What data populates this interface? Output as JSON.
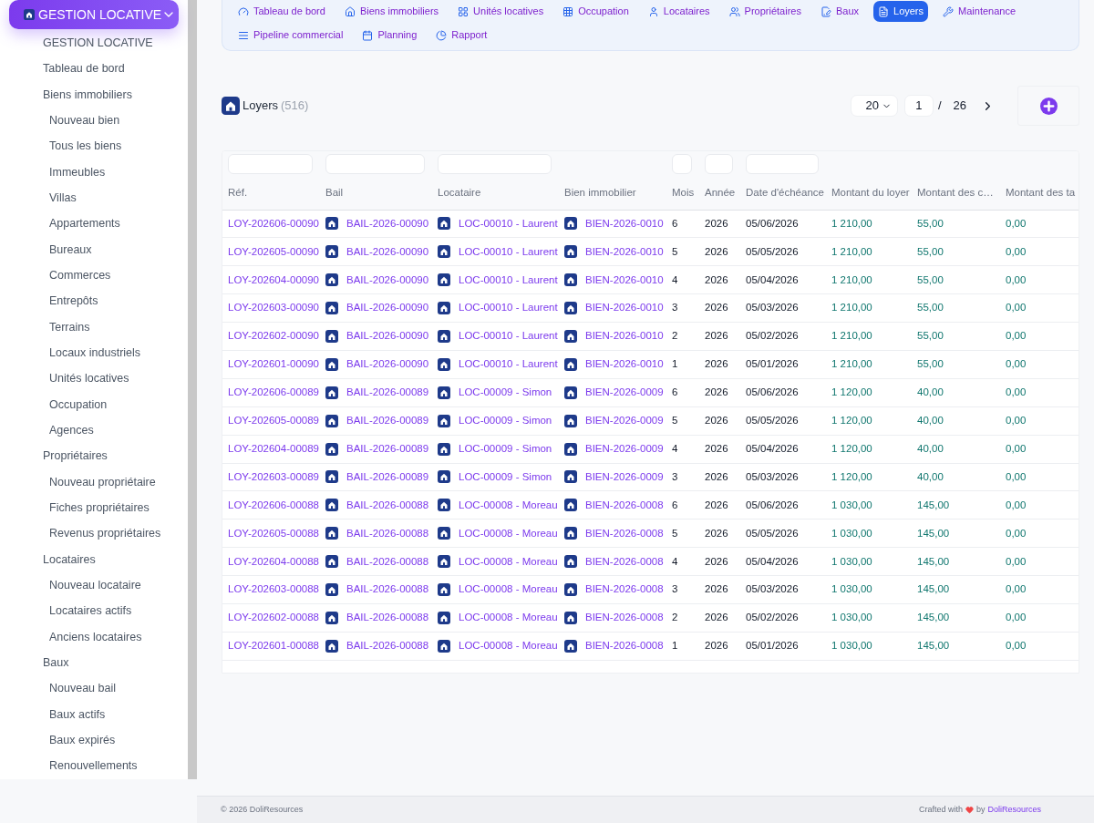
{
  "sidebar": {
    "header": {
      "title": "GESTION LOCATIVE"
    },
    "items": [
      {
        "label": "GESTION LOCATIVE"
      },
      {
        "label": "Tableau de bord"
      },
      {
        "label": "Biens immobiliers",
        "children": [
          {
            "label": "Nouveau bien"
          },
          {
            "label": "Tous les biens"
          },
          {
            "label": "Immeubles"
          },
          {
            "label": "Villas"
          },
          {
            "label": "Appartements"
          },
          {
            "label": "Bureaux"
          },
          {
            "label": "Commerces"
          },
          {
            "label": "Entrepôts"
          },
          {
            "label": "Terrains"
          },
          {
            "label": "Locaux industriels"
          },
          {
            "label": "Unités locatives"
          },
          {
            "label": "Occupation"
          },
          {
            "label": "Agences"
          }
        ]
      },
      {
        "label": "Propriétaires",
        "children": [
          {
            "label": "Nouveau propriétaire"
          },
          {
            "label": "Fiches propriétaires"
          },
          {
            "label": "Revenus propriétaires"
          }
        ]
      },
      {
        "label": "Locataires",
        "children": [
          {
            "label": "Nouveau locataire"
          },
          {
            "label": "Locataires actifs"
          },
          {
            "label": "Anciens locataires"
          }
        ]
      },
      {
        "label": "Baux",
        "children": [
          {
            "label": "Nouveau bail"
          },
          {
            "label": "Baux actifs"
          },
          {
            "label": "Baux expirés"
          },
          {
            "label": "Renouvellements"
          }
        ]
      }
    ]
  },
  "nav_tabs": [
    {
      "label": "Tableau de bord",
      "selected": false
    },
    {
      "label": "Biens immobiliers",
      "selected": false
    },
    {
      "label": "Unités locatives",
      "selected": false
    },
    {
      "label": "Occupation",
      "selected": false
    },
    {
      "label": "Locataires",
      "selected": false
    },
    {
      "label": "Propriétaires",
      "selected": false
    },
    {
      "label": "Baux",
      "selected": false
    },
    {
      "label": "Loyers",
      "selected": true
    },
    {
      "label": "Maintenance",
      "selected": false
    },
    {
      "label": "Pipeline commercial",
      "selected": false
    },
    {
      "label": "Planning",
      "selected": false
    },
    {
      "label": "Rapport",
      "selected": false
    }
  ],
  "page_header": {
    "title": "Loyers",
    "count": "(516)"
  },
  "pagination": {
    "page_size": "20",
    "page": "1",
    "separator": "/",
    "total": "26"
  },
  "table": {
    "columns": [
      {
        "label": "Réf.",
        "filter": true
      },
      {
        "label": "Bail",
        "filter": true
      },
      {
        "label": "Locataire",
        "filter": true
      },
      {
        "label": "Bien immobilier",
        "filter": false
      },
      {
        "label": "Mois",
        "filter": true
      },
      {
        "label": "Année",
        "filter": true
      },
      {
        "label": "Date d'échéance",
        "filter": true
      },
      {
        "label": "Montant du loyer",
        "filter": false
      },
      {
        "label": "Montant des c…",
        "filter": false
      },
      {
        "label": "Montant des ta",
        "filter": false
      }
    ],
    "rows": [
      [
        "LOY-202606-00090",
        "BAIL-2026-00090",
        "LOC-00010 - Laurent",
        "BIEN-2026-0010",
        "6",
        "2026",
        "05/06/2026",
        "1 210,00",
        "55,00",
        "0,00"
      ],
      [
        "LOY-202605-00090",
        "BAIL-2026-00090",
        "LOC-00010 - Laurent",
        "BIEN-2026-0010",
        "5",
        "2026",
        "05/05/2026",
        "1 210,00",
        "55,00",
        "0,00"
      ],
      [
        "LOY-202604-00090",
        "BAIL-2026-00090",
        "LOC-00010 - Laurent",
        "BIEN-2026-0010",
        "4",
        "2026",
        "05/04/2026",
        "1 210,00",
        "55,00",
        "0,00"
      ],
      [
        "LOY-202603-00090",
        "BAIL-2026-00090",
        "LOC-00010 - Laurent",
        "BIEN-2026-0010",
        "3",
        "2026",
        "05/03/2026",
        "1 210,00",
        "55,00",
        "0,00"
      ],
      [
        "LOY-202602-00090",
        "BAIL-2026-00090",
        "LOC-00010 - Laurent",
        "BIEN-2026-0010",
        "2",
        "2026",
        "05/02/2026",
        "1 210,00",
        "55,00",
        "0,00"
      ],
      [
        "LOY-202601-00090",
        "BAIL-2026-00090",
        "LOC-00010 - Laurent",
        "BIEN-2026-0010",
        "1",
        "2026",
        "05/01/2026",
        "1 210,00",
        "55,00",
        "0,00"
      ],
      [
        "LOY-202606-00089",
        "BAIL-2026-00089",
        "LOC-00009 - Simon",
        "BIEN-2026-0009",
        "6",
        "2026",
        "05/06/2026",
        "1 120,00",
        "40,00",
        "0,00"
      ],
      [
        "LOY-202605-00089",
        "BAIL-2026-00089",
        "LOC-00009 - Simon",
        "BIEN-2026-0009",
        "5",
        "2026",
        "05/05/2026",
        "1 120,00",
        "40,00",
        "0,00"
      ],
      [
        "LOY-202604-00089",
        "BAIL-2026-00089",
        "LOC-00009 - Simon",
        "BIEN-2026-0009",
        "4",
        "2026",
        "05/04/2026",
        "1 120,00",
        "40,00",
        "0,00"
      ],
      [
        "LOY-202603-00089",
        "BAIL-2026-00089",
        "LOC-00009 - Simon",
        "BIEN-2026-0009",
        "3",
        "2026",
        "05/03/2026",
        "1 120,00",
        "40,00",
        "0,00"
      ],
      [
        "LOY-202606-00088",
        "BAIL-2026-00088",
        "LOC-00008 - Moreau",
        "BIEN-2026-0008",
        "6",
        "2026",
        "05/06/2026",
        "1 030,00",
        "145,00",
        "0,00"
      ],
      [
        "LOY-202605-00088",
        "BAIL-2026-00088",
        "LOC-00008 - Moreau",
        "BIEN-2026-0008",
        "5",
        "2026",
        "05/05/2026",
        "1 030,00",
        "145,00",
        "0,00"
      ],
      [
        "LOY-202604-00088",
        "BAIL-2026-00088",
        "LOC-00008 - Moreau",
        "BIEN-2026-0008",
        "4",
        "2026",
        "05/04/2026",
        "1 030,00",
        "145,00",
        "0,00"
      ],
      [
        "LOY-202603-00088",
        "BAIL-2026-00088",
        "LOC-00008 - Moreau",
        "BIEN-2026-0008",
        "3",
        "2026",
        "05/03/2026",
        "1 030,00",
        "145,00",
        "0,00"
      ],
      [
        "LOY-202602-00088",
        "BAIL-2026-00088",
        "LOC-00008 - Moreau",
        "BIEN-2026-0008",
        "2",
        "2026",
        "05/02/2026",
        "1 030,00",
        "145,00",
        "0,00"
      ],
      [
        "LOY-202601-00088",
        "BAIL-2026-00088",
        "LOC-00008 - Moreau",
        "BIEN-2026-0008",
        "1",
        "2026",
        "05/01/2026",
        "1 030,00",
        "145,00",
        "0,00"
      ]
    ]
  },
  "footer": {
    "copyright": "© 2026 DoliResources",
    "crafted": "Crafted with",
    "by": "by",
    "brand": "DoliResources"
  }
}
